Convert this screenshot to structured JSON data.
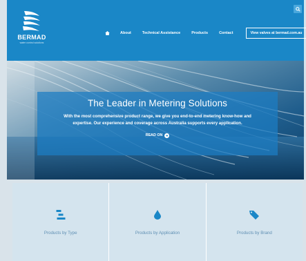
{
  "brand": {
    "name": "BERMAD",
    "tagline": "water control solutions"
  },
  "nav": {
    "home_icon": "home-icon",
    "items": [
      "About",
      "Technical Assistance",
      "Products",
      "Contact"
    ],
    "cta": "View valves at bermad.com.au"
  },
  "search_icon": "search-icon",
  "hero": {
    "title": "The Leader in Metering Solutions",
    "body": "With the most comprehensive product range, we give you end-to-end metering know-how and expertise. Our experience and coverage across Australia supports every application.",
    "read_on": "READ ON"
  },
  "cards": [
    {
      "label": "Products by Type",
      "icon": "list-icon"
    },
    {
      "label": "Products by Application",
      "icon": "water-drop-icon"
    },
    {
      "label": "Products by Brand",
      "icon": "tag-icon"
    }
  ],
  "colors": {
    "brand_blue": "#1a87c7",
    "card_bg": "#d4e4ee",
    "card_icon": "#1a87c7",
    "card_text": "#5f8fb3"
  }
}
